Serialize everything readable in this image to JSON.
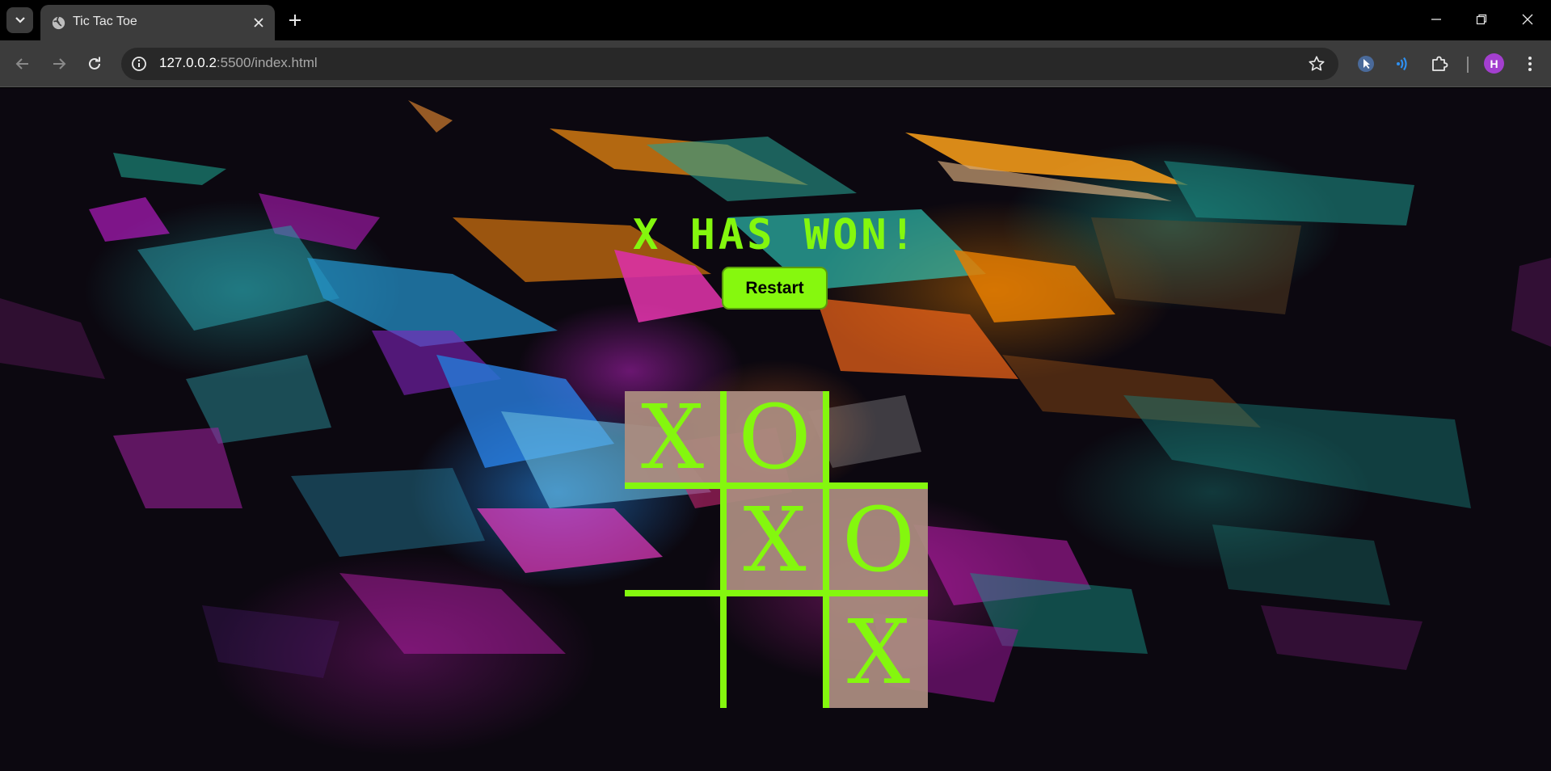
{
  "browser": {
    "tab_title": "Tic Tac Toe",
    "url_host": "127.0.0.2",
    "url_rest": ":5500/index.html",
    "profile_initial": "H"
  },
  "game": {
    "status": "X HAS WON!",
    "restart_label": "Restart",
    "board": [
      "X",
      "O",
      "",
      "",
      "X",
      "O",
      "",
      "",
      "X"
    ]
  },
  "colors": {
    "accent": "#84f70e",
    "cell": "#ab8c80"
  }
}
